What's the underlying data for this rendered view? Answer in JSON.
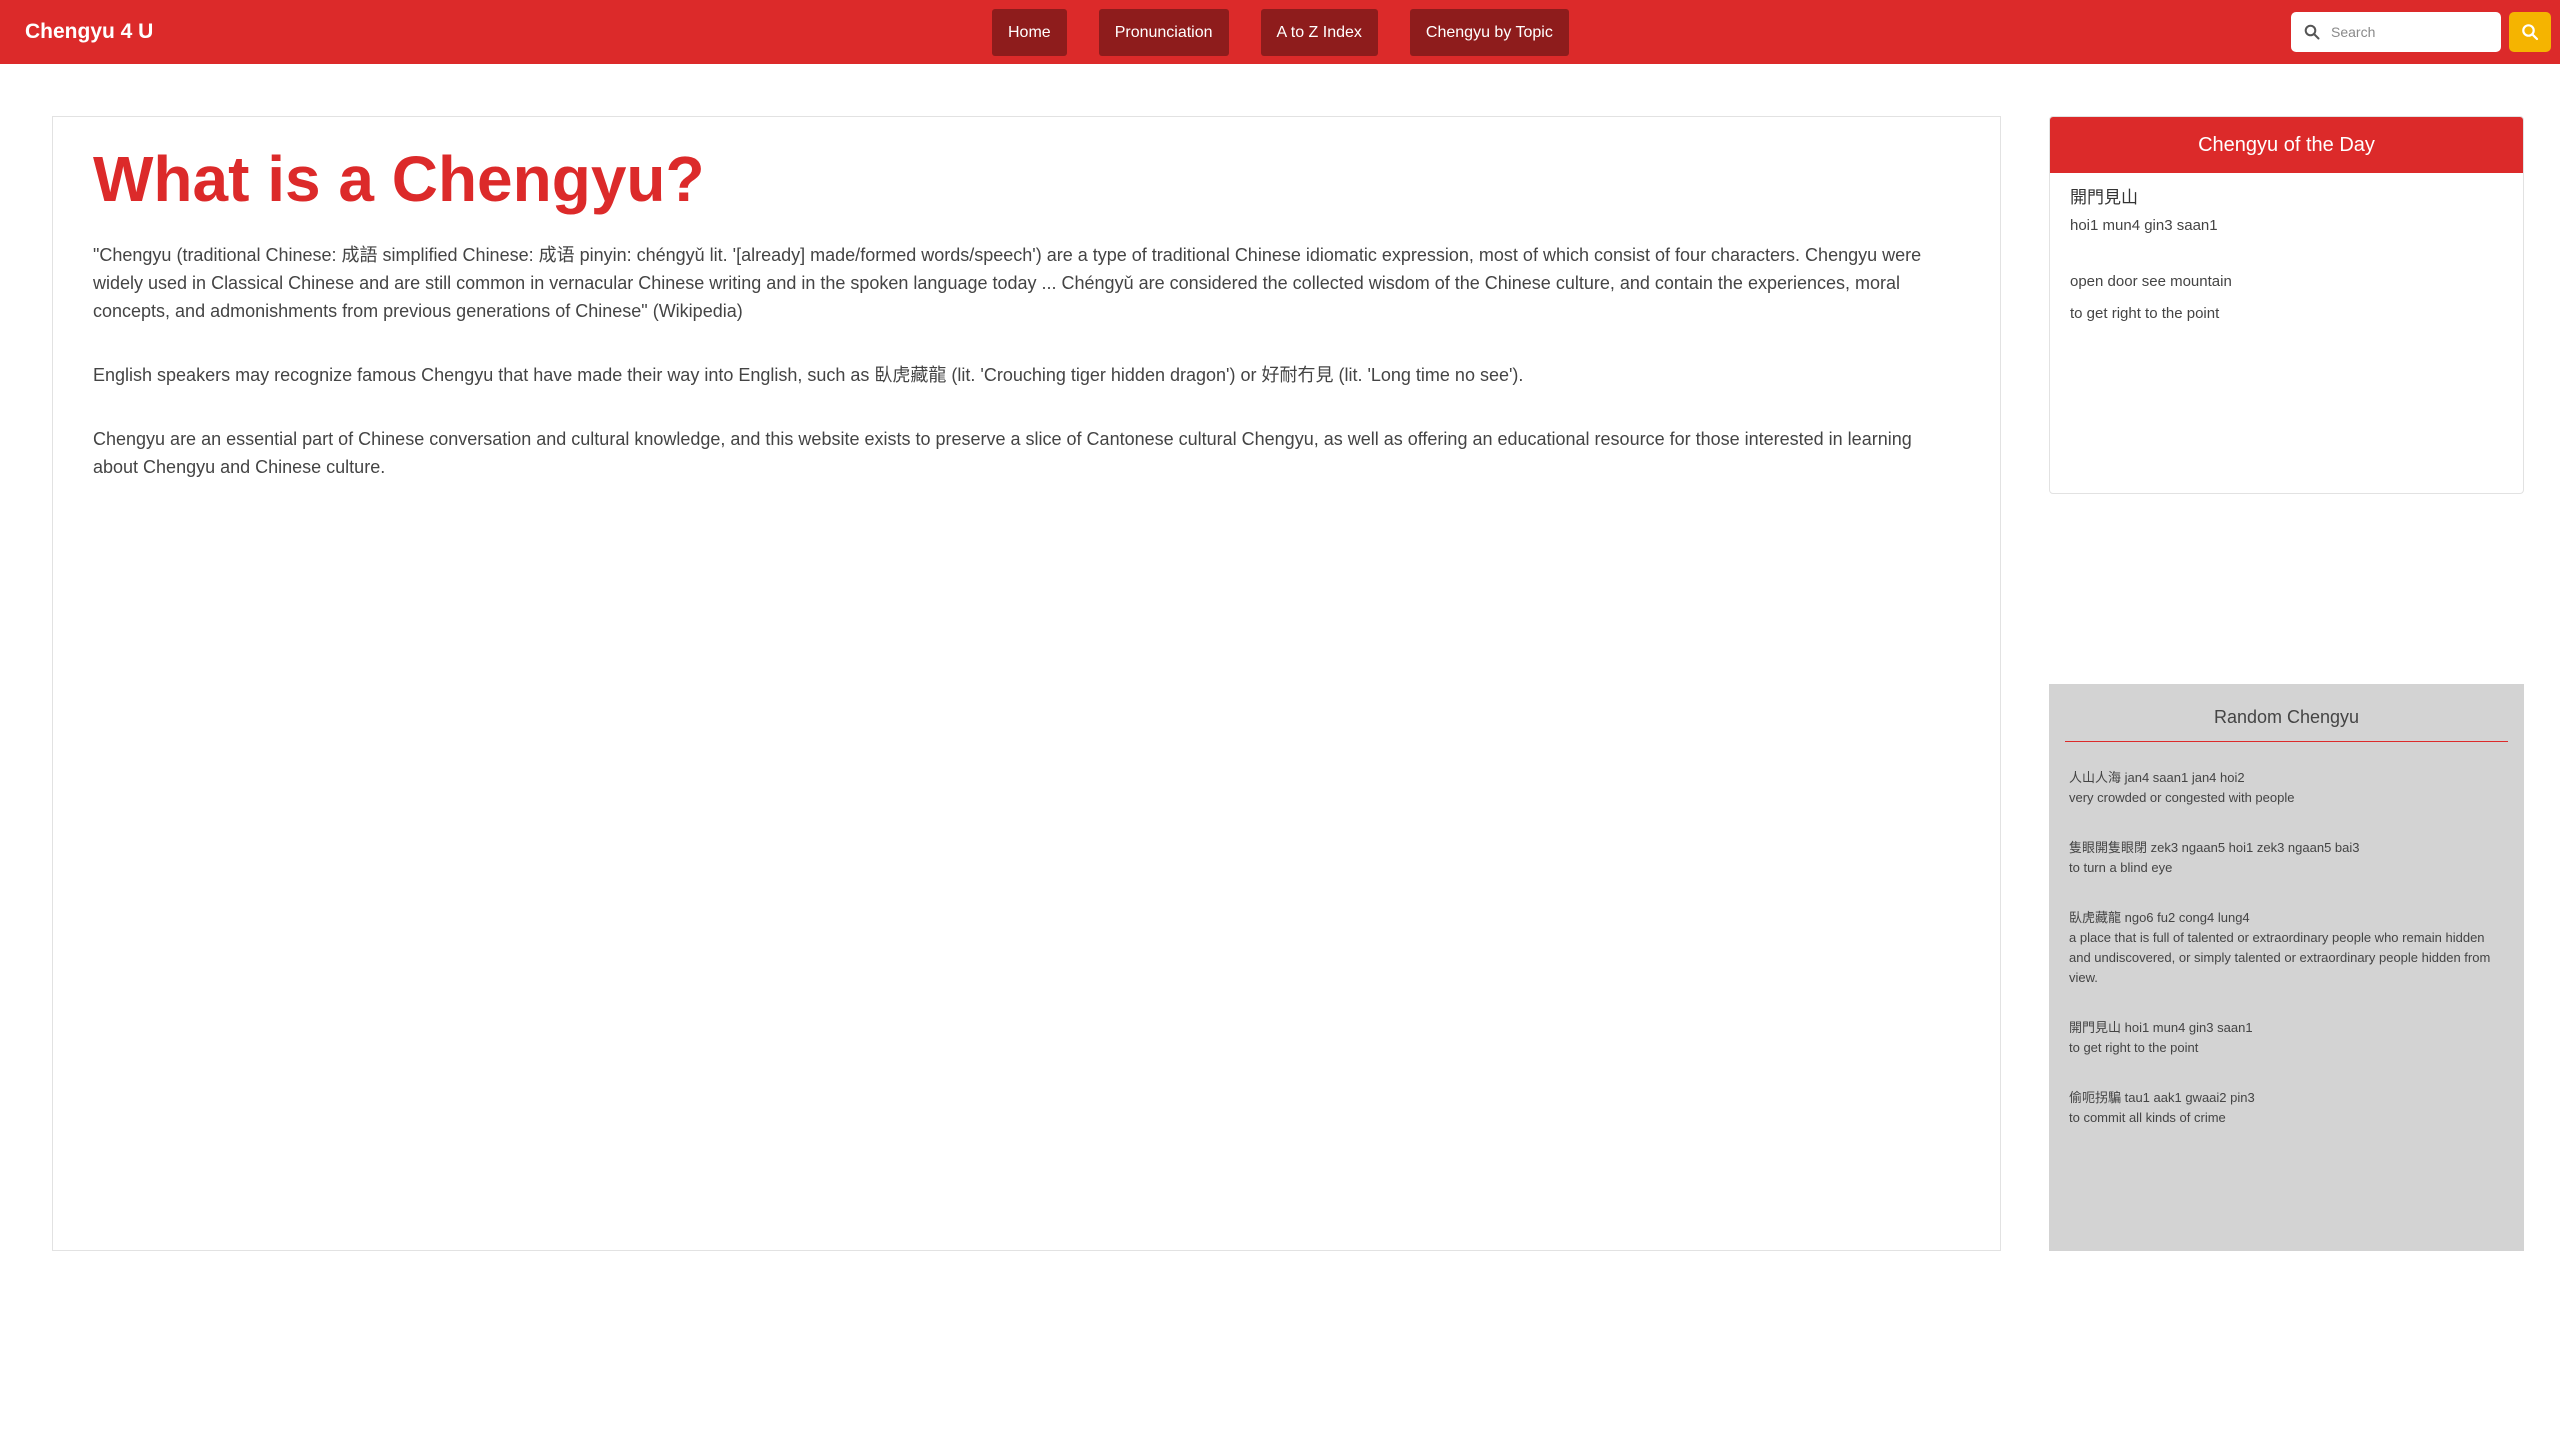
{
  "navbar": {
    "brand": "Chengyu 4 U",
    "links": [
      {
        "label": "Home"
      },
      {
        "label": "Pronunciation"
      },
      {
        "label": "A to Z Index"
      },
      {
        "label": "Chengyu by Topic"
      }
    ],
    "search": {
      "placeholder": "Search",
      "value": ""
    },
    "accent_color": "#dc2a2a",
    "link_bg_color": "#8e1c1c",
    "search_button_color": "#f5b400"
  },
  "main": {
    "title": "What is a Chengyu?",
    "paragraphs": [
      "\"Chengyu (traditional Chinese: 成語 simplified Chinese: 成语 pinyin: chéngyǔ lit. '[already] made/formed words/speech') are a type of traditional Chinese idiomatic expression, most of which consist of four characters. Chengyu were widely used in Classical Chinese and are still common in vernacular Chinese writing and in the spoken language today ... Chéngyǔ are considered the collected wisdom of the Chinese culture, and contain the experiences, moral concepts, and admonishments from previous generations of Chinese\" (Wikipedia)",
      "English speakers may recognize famous Chengyu that have made their way into English, such as 臥虎藏龍 (lit. 'Crouching tiger hidden dragon') or 好耐冇見 (lit. 'Long time no see').",
      "Chengyu are an essential part of Chinese conversation and cultural knowledge, and this website exists to preserve a slice of Cantonese cultural Chengyu, as well as offering an educational resource for those interested in learning about Chengyu and Chinese culture."
    ]
  },
  "chengyu_of_the_day": {
    "header": "Chengyu of the Day",
    "characters": "開門見山",
    "jyutping": "hoi1 mun4 gin3 saan1",
    "literal": "open door see mountain",
    "meaning": "to get right to the point"
  },
  "random_chengyu": {
    "title": "Random Chengyu",
    "items": [
      {
        "head": "人山人海 jan4 saan1 jan4 hoi2",
        "meaning": "very crowded or congested with people"
      },
      {
        "head": "隻眼開隻眼閉 zek3 ngaan5 hoi1 zek3 ngaan5 bai3",
        "meaning": "to turn a blind eye"
      },
      {
        "head": "臥虎藏龍 ngo6 fu2 cong4 lung4",
        "meaning": "a place that is full of talented or extraordinary people who remain hidden and undiscovered, or simply talented or extraordinary people hidden from view."
      },
      {
        "head": "開門見山 hoi1 mun4 gin3 saan1",
        "meaning": "to get right to the point"
      },
      {
        "head": "偷呃拐騙 tau1 aak1 gwaai2 pin3",
        "meaning": "to commit all kinds of crime"
      }
    ]
  }
}
